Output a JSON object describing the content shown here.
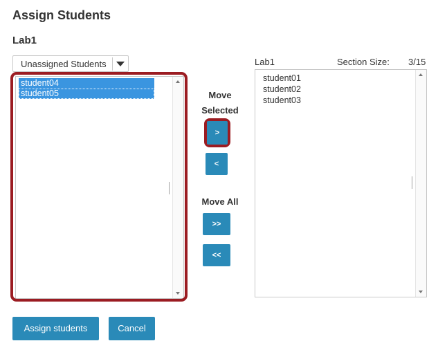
{
  "page": {
    "title": "Assign Students",
    "section": "Lab1"
  },
  "source": {
    "dropdown_selected": "Unassigned Students",
    "options": [
      "student04",
      "student05"
    ]
  },
  "middle": {
    "move_selected_line1": "Move",
    "move_selected_line2": "Selected",
    "move_right_label": ">",
    "move_left_label": "<",
    "move_all_label": "Move All",
    "move_all_right_label": ">>",
    "move_all_left_label": "<<"
  },
  "target": {
    "name": "Lab1",
    "section_size_label": "Section Size:",
    "section_size_value": "3/15",
    "options": [
      "student01",
      "student02",
      "student03"
    ]
  },
  "actions": {
    "assign_label": "Assign students",
    "cancel_label": "Cancel"
  },
  "colors": {
    "button_blue": "#2a8ab8",
    "highlight_red": "#9b1c22",
    "selection_blue": "#3a95e0"
  }
}
